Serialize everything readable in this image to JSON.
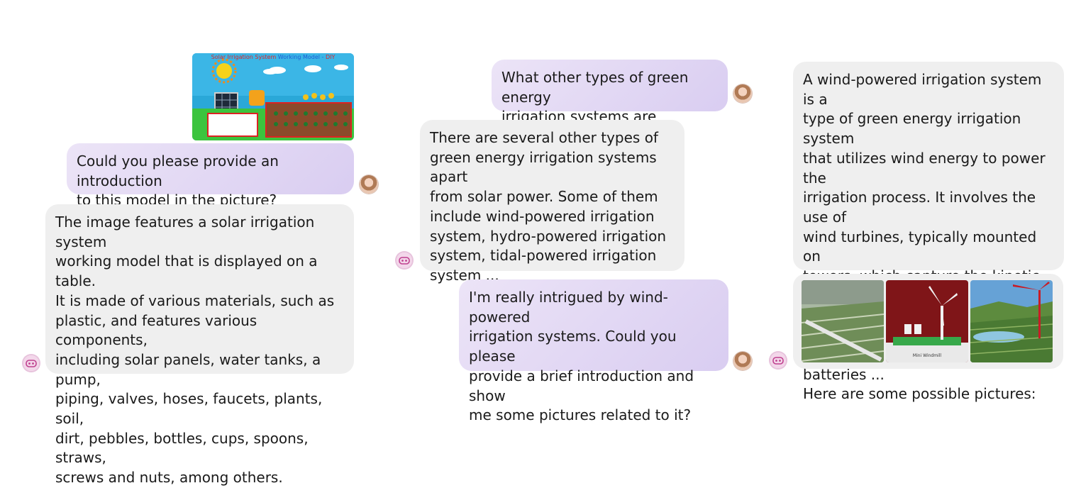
{
  "conversation_1": {
    "image_caption_prefix": "Solar Irrigation System",
    "image_caption_mid": " Working Model - ",
    "image_caption_suffix": "DIY",
    "user_message": "Could you please provide an introduction\nto this model in the picture?",
    "bot_message": "The image features a solar irrigation system\nworking model that is displayed on a table.\nIt is made of various materials, such as\nplastic, and features various components,\nincluding solar panels, water tanks, a pump,\npiping, valves, hoses, faucets, plants, soil,\ndirt, pebbles, bottles, cups, spoons, straws,\nscrews and nuts, among others."
  },
  "conversation_2": {
    "user_message_1": "What other types of green energy\nirrigation systems are feasible?",
    "bot_message": "There are several other types of\ngreen energy irrigation systems apart\nfrom solar power. Some of them\ninclude wind-powered irrigation\nsystem, hydro-powered irrigation\nsystem, tidal-powered irrigation\nsystem ...",
    "user_message_2": "I'm really intrigued by wind-powered\nirrigation systems. Could you please\nprovide a brief introduction and show\nme some pictures related to it?"
  },
  "conversation_3": {
    "bot_message": "A wind-powered irrigation system is a\ntype of green energy irrigation system\nthat utilizes wind energy to power the\nirrigation process. It involves the use of\nwind turbines, typically mounted on\ntowers, which capture the kinetic\nenergy of the wind and convert it into\nelectrical energy. The generated\nelectricity can be stored in batteries ...\nHere are some possible pictures:",
    "gallery_label": "Mini Windmill"
  },
  "icons": {
    "user_avatar": "user-avatar-icon",
    "bot_avatar": "robot-avatar-icon"
  },
  "colors": {
    "user_bubble": "#ddd2f2",
    "bot_bubble": "#efefef",
    "caption_red": "#e0262b",
    "caption_blue": "#1f5fd6"
  }
}
